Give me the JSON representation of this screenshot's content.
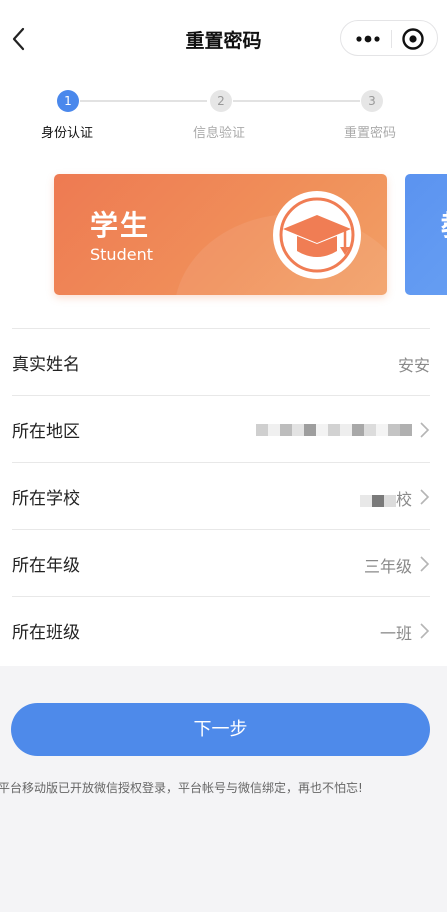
{
  "header": {
    "title": "重置密码"
  },
  "steps": [
    {
      "num": "1",
      "label": "身份认证",
      "state": "active"
    },
    {
      "num": "2",
      "label": "信息验证",
      "state": "inactive"
    },
    {
      "num": "3",
      "label": "重置密码",
      "state": "inactive"
    }
  ],
  "cards": {
    "student": {
      "title": "学生",
      "subtitle": "Student"
    },
    "teacher": {
      "title": "教"
    }
  },
  "form": {
    "name": {
      "label": "真实姓名",
      "value": "安安"
    },
    "region": {
      "label": "所在地区",
      "value": ""
    },
    "school": {
      "label": "所在学校",
      "value": "校"
    },
    "grade": {
      "label": "所在年级",
      "value": "三年级"
    },
    "class": {
      "label": "所在班级",
      "value": "一班"
    }
  },
  "actions": {
    "next_label": "下一步"
  },
  "notice": "平台移动版已开放微信授权登录，平台帐号与微信绑定，再也不怕忘!",
  "colors": {
    "accent": "#4e8aea",
    "student_card": "#ee7a52",
    "teacher_card": "#5b93f0"
  }
}
